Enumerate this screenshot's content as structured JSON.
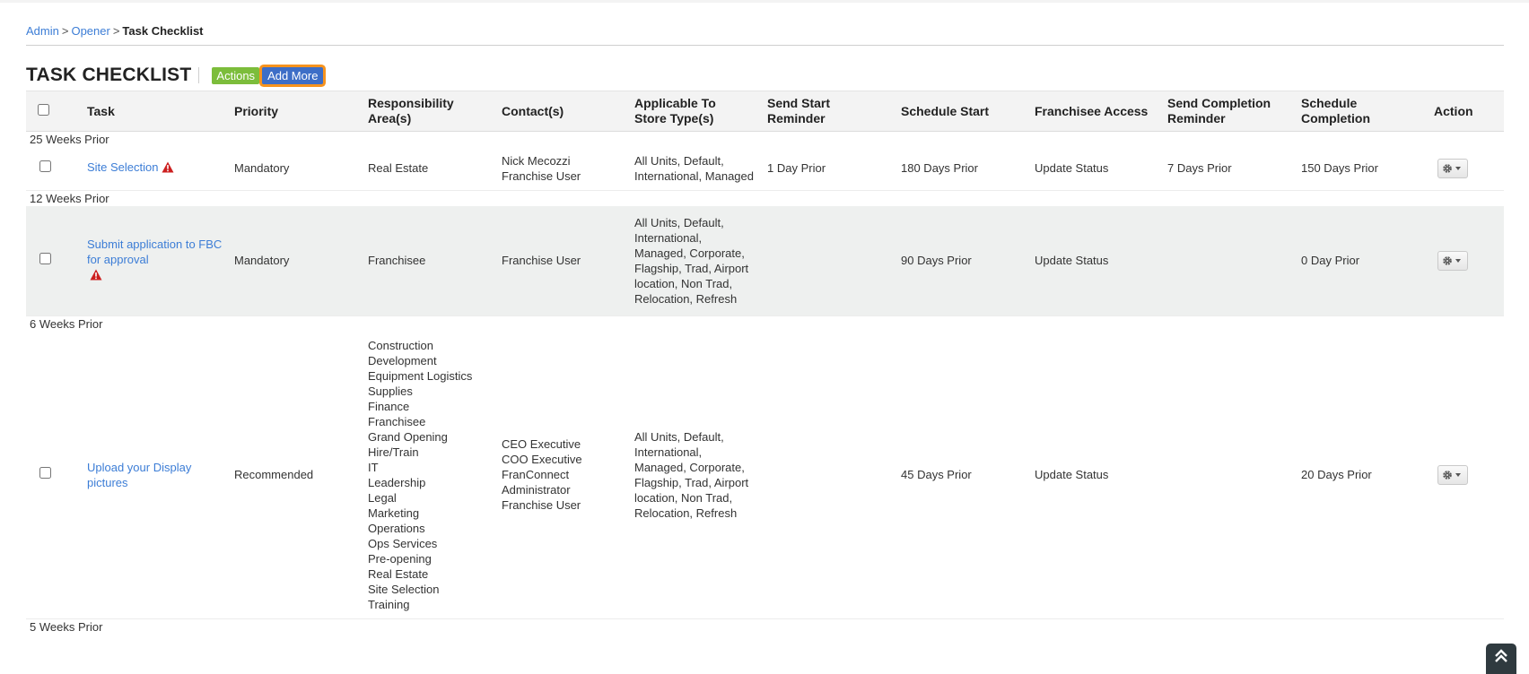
{
  "breadcrumb": {
    "admin": "Admin",
    "opener": "Opener",
    "current": "Task Checklist",
    "separator": ">"
  },
  "page": {
    "title": "TASK CHECKLIST",
    "actions_label": "Actions",
    "add_more_label": "Add More"
  },
  "columns": {
    "task": "Task",
    "priority": "Priority",
    "responsibility_l1": "Responsibility",
    "responsibility_l2": "Area(s)",
    "contacts": "Contact(s)",
    "applicable_l1": "Applicable To",
    "applicable_l2": "Store Type(s)",
    "send_start_l1": "Send Start",
    "send_start_l2": "Reminder",
    "schedule_start": "Schedule Start",
    "franchisee_access": "Franchisee Access",
    "send_completion_l1": "Send Completion",
    "send_completion_l2": "Reminder",
    "schedule_completion_l1": "Schedule",
    "schedule_completion_l2": "Completion",
    "action": "Action"
  },
  "groups": [
    {
      "label": "25 Weeks Prior",
      "task": {
        "name": "Site Selection",
        "priority": "Mandatory",
        "responsibility": [
          "Real Estate"
        ],
        "contacts": [
          "Nick Mecozzi",
          "Franchise User"
        ],
        "applicable": [
          "All Units, Default,",
          "International, Managed"
        ],
        "send_start": "1 Day Prior",
        "schedule_start": "180 Days Prior",
        "franchisee_access": "Update Status",
        "send_completion": "7 Days Prior",
        "schedule_completion": "150 Days Prior"
      }
    },
    {
      "label": "12 Weeks Prior",
      "task": {
        "name_l1": "Submit application to FBC",
        "name_l2": "for approval",
        "priority": "Mandatory",
        "responsibility": [
          "Franchisee"
        ],
        "contacts": [
          "Franchise User"
        ],
        "applicable": [
          "All Units, Default,",
          "International,",
          "Managed, Corporate,",
          "Flagship, Trad, Airport",
          "location, Non Trad,",
          "Relocation, Refresh"
        ],
        "send_start": "",
        "schedule_start": "90 Days Prior",
        "franchisee_access": "Update Status",
        "send_completion": "",
        "schedule_completion": "0 Day Prior"
      }
    },
    {
      "label": "6 Weeks Prior",
      "task": {
        "name_l1": "Upload your Display",
        "name_l2": "pictures",
        "priority": "Recommended",
        "responsibility": [
          "Construction",
          "Development",
          "Equipment Logistics",
          "Supplies",
          "Finance",
          "Franchisee",
          "Grand Opening",
          "Hire/Train",
          "IT",
          "Leadership",
          "Legal",
          "Marketing",
          "Operations",
          "Ops Services",
          "Pre-opening",
          "Real Estate",
          "Site Selection",
          "Training"
        ],
        "contacts": [
          "CEO Executive",
          "COO Executive",
          "FranConnect",
          "Administrator",
          "Franchise User"
        ],
        "applicable": [
          "All Units, Default,",
          "International,",
          "Managed, Corporate,",
          "Flagship, Trad, Airport",
          "location, Non Trad,",
          "Relocation, Refresh"
        ],
        "send_start": "",
        "schedule_start": "45 Days Prior",
        "franchisee_access": "Update Status",
        "send_completion": "",
        "schedule_completion": "20 Days Prior"
      }
    },
    {
      "label": "5 Weeks Prior"
    }
  ],
  "icons": {
    "warning": "warning-triangle-icon",
    "gear": "gear-icon",
    "caret": "caret-down-icon",
    "scroll_top": "double-chevron-up-icon"
  },
  "colors": {
    "link": "#3c7dd6",
    "actions_button": "#7cbd3b",
    "add_more_button": "#3d6ec7",
    "add_more_outline": "#f7931e",
    "warning": "#cc1f1f",
    "header_bg": "#f3f3f3",
    "shaded_row": "#eef0ef"
  }
}
